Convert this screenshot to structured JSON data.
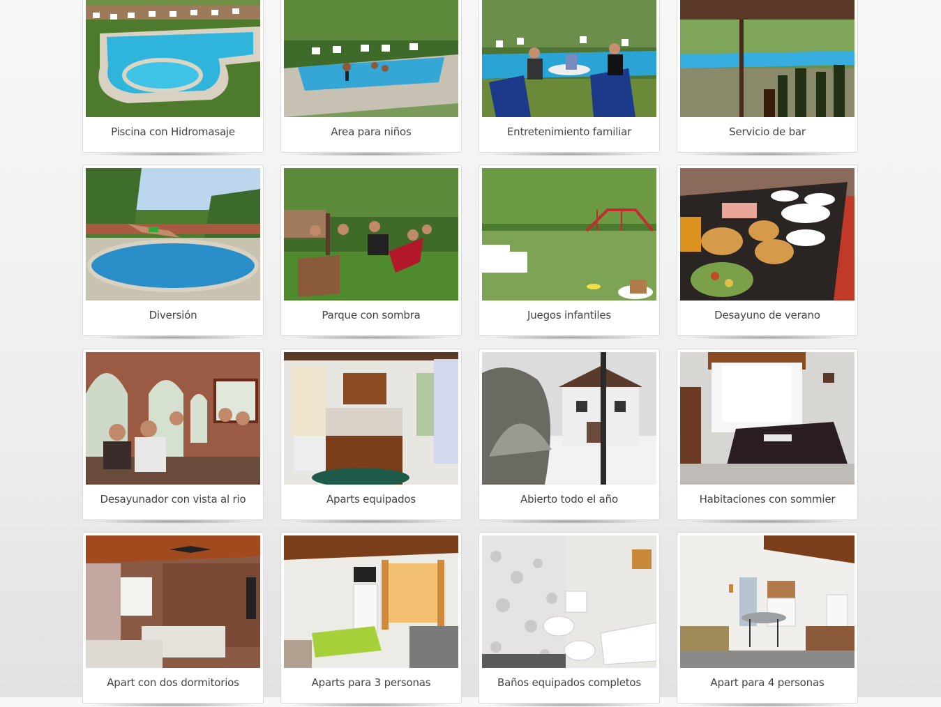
{
  "gallery": {
    "items": [
      {
        "caption": "Piscina con Hidromasaje",
        "icon": "photo-pool-hydromassage"
      },
      {
        "caption": "Area para niños",
        "icon": "photo-kids-area"
      },
      {
        "caption": "Entretenimiento familiar",
        "icon": "photo-family-entertainment"
      },
      {
        "caption": "Servicio de bar",
        "icon": "photo-bar-service"
      },
      {
        "caption": "Diversión",
        "icon": "photo-diving"
      },
      {
        "caption": "Parque con sombra",
        "icon": "photo-shaded-park"
      },
      {
        "caption": "Juegos infantiles",
        "icon": "photo-playground"
      },
      {
        "caption": "Desayuno de verano",
        "icon": "photo-summer-breakfast"
      },
      {
        "caption": "Desayunador con vista al rio",
        "icon": "photo-breakfast-room"
      },
      {
        "caption": "Aparts equipados",
        "icon": "photo-kitchen"
      },
      {
        "caption": "Abierto todo el año",
        "icon": "photo-snow-house"
      },
      {
        "caption": "Habitaciones con sommier",
        "icon": "photo-bedroom"
      },
      {
        "caption": "Apart con dos dormitorios",
        "icon": "photo-twin-room"
      },
      {
        "caption": "Aparts para 3 personas",
        "icon": "photo-apart-3"
      },
      {
        "caption": "Baños equipados completos",
        "icon": "photo-bathroom"
      },
      {
        "caption": "Apart para 4 personas",
        "icon": "photo-apart-4"
      }
    ]
  }
}
